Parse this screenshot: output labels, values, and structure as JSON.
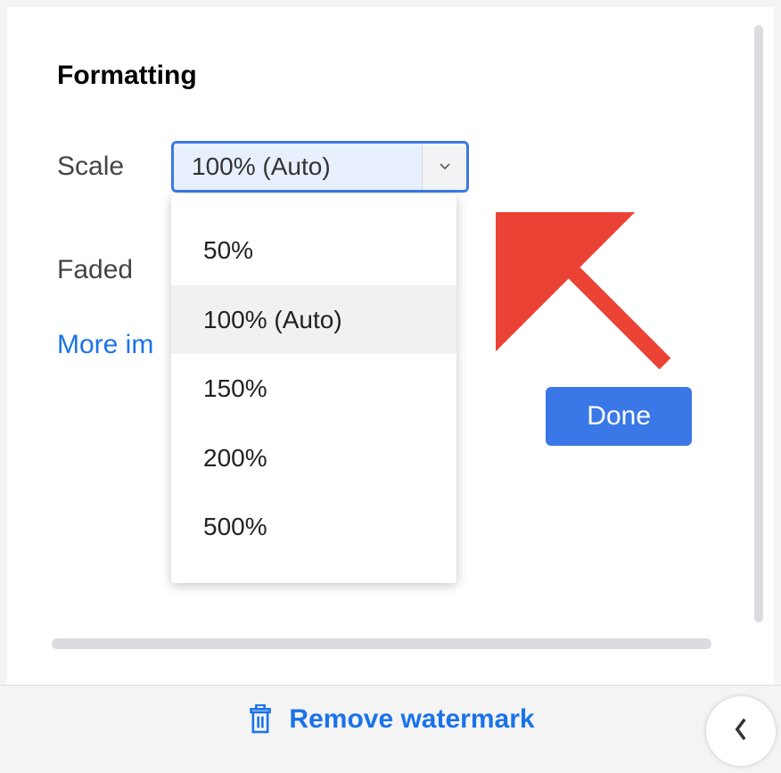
{
  "formatting": {
    "title": "Formatting",
    "scale": {
      "label": "Scale",
      "value": "100% (Auto)",
      "options": [
        "50%",
        "100% (Auto)",
        "150%",
        "200%",
        "500%"
      ],
      "selected_index": 1
    },
    "faded": {
      "label": "Faded"
    },
    "more_images_link": "More im",
    "done_label": "Done"
  },
  "footer": {
    "remove_label": "Remove watermark"
  },
  "colors": {
    "accent_blue": "#3b78e7",
    "link_blue": "#1a73e8",
    "arrow_red": "#ea4335"
  }
}
